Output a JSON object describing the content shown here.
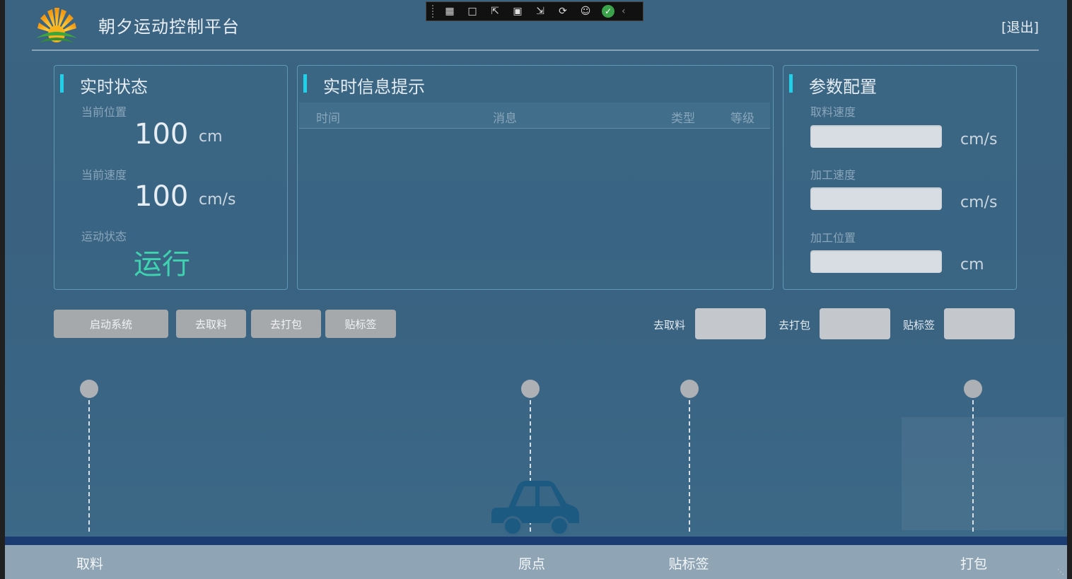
{
  "header": {
    "title": "朝夕运动控制平台",
    "logout": "[退出]"
  },
  "status_panel": {
    "title": "实时状态",
    "position_label": "当前位置",
    "position_value": "100",
    "position_unit": "cm",
    "speed_label": "当前速度",
    "speed_value": "100",
    "speed_unit": "cm/s",
    "motion_label": "运动状态",
    "motion_value": "运行"
  },
  "info_panel": {
    "title": "实时信息提示",
    "columns": [
      "时间",
      "消息",
      "类型",
      "等级"
    ]
  },
  "param_panel": {
    "title": "参数配置",
    "fields": [
      {
        "label": "取料速度",
        "value": "",
        "unit": "cm/s"
      },
      {
        "label": "加工速度",
        "value": "",
        "unit": "cm/s"
      },
      {
        "label": "加工位置",
        "value": "",
        "unit": "cm"
      }
    ]
  },
  "actions": {
    "start": "启动系统",
    "go_pick": "去取料",
    "go_pack": "去打包",
    "label": "贴标签"
  },
  "indicators": {
    "go_pick": "去取料",
    "go_pack": "去打包",
    "label": "贴标签"
  },
  "stations": [
    "取料",
    "原点",
    "贴标签",
    "打包"
  ],
  "colors": {
    "accent_bar": "#1fd0e8",
    "running_status": "#3fd2b0",
    "rail": "#1b3b73",
    "car": "#1c5a82"
  },
  "devbar": {
    "icons": [
      "live-tree-icon",
      "record-icon",
      "select-element-icon",
      "frame-icon",
      "track-focus-icon",
      "hot-reload-icon",
      "accessibility-icon",
      "check-icon",
      "collapse-icon"
    ]
  }
}
